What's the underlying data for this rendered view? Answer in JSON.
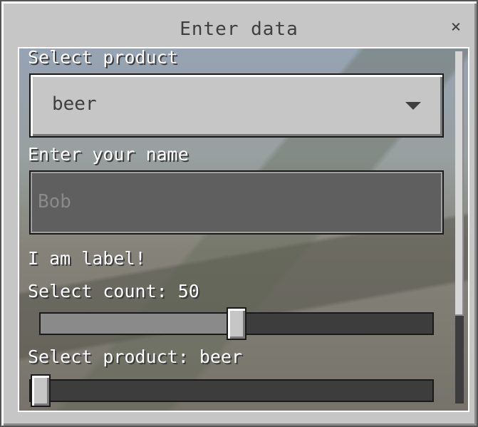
{
  "window": {
    "title": "Enter data",
    "close_glyph": "×"
  },
  "form": {
    "product_label": "Select product",
    "product_selected": "beer",
    "name_label": "Enter your name",
    "name_value": "",
    "name_placeholder": "Bob",
    "static_label": "I am label!",
    "count_label": "Select count: 50",
    "count_slider_fraction": 0.5,
    "product_slider_label": "Select product: beer",
    "product_slider_fraction": 0.0
  },
  "scrollbar": {
    "visible_fraction": 0.75,
    "position_fraction": 0.0
  },
  "icons": {
    "close": "close-icon",
    "dropdown": "chevron-down-icon"
  }
}
